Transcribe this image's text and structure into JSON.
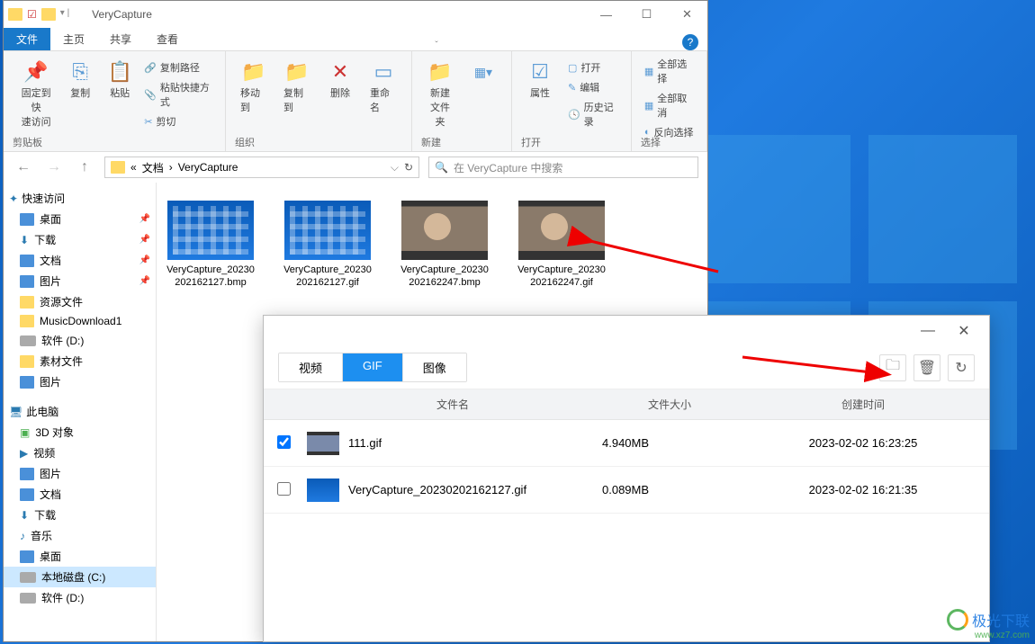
{
  "explorer": {
    "title": "VeryCapture",
    "tabs": {
      "file": "文件",
      "home": "主页",
      "share": "共享",
      "view": "查看"
    },
    "ribbon": {
      "pin": "固定到快\n速访问",
      "copy": "复制",
      "paste": "粘贴",
      "copyPath": "复制路径",
      "pasteShortcut": "粘贴快捷方式",
      "cut": "剪切",
      "clipboard": "剪贴板",
      "moveTo": "移动到",
      "copyTo": "复制到",
      "delete": "删除",
      "rename": "重命名",
      "organize": "组织",
      "newFolder": "新建\n文件夹",
      "new": "新建",
      "properties": "属性",
      "openLbl": "打开",
      "edit": "编辑",
      "history": "历史记录",
      "open": "打开",
      "selectAll": "全部选择",
      "selectNone": "全部取消",
      "selectInvert": "反向选择",
      "select": "选择"
    },
    "breadcrumb": {
      "seg1": "文档",
      "seg2": "VeryCapture",
      "sep": "›"
    },
    "searchPlaceholder": "在 VeryCapture 中搜索",
    "sidebar": {
      "quickAccess": "快速访问",
      "desktop": "桌面",
      "downloads": "下载",
      "documents": "文档",
      "pictures": "图片",
      "resources": "资源文件",
      "music": "MusicDownload1",
      "diskD": "软件 (D:)",
      "material": "素材文件",
      "pictures2": "图片",
      "thisPC": "此电脑",
      "obj3d": "3D 对象",
      "videos": "视频",
      "pictures3": "图片",
      "documents2": "文档",
      "downloads2": "下载",
      "musics": "音乐",
      "desktop2": "桌面",
      "diskC": "本地磁盘 (C:)",
      "diskD2": "软件 (D:)"
    },
    "files": [
      {
        "name": "VeryCapture_20230202162127.bmp",
        "type": "desktop"
      },
      {
        "name": "VeryCapture_20230202162127.gif",
        "type": "desktop"
      },
      {
        "name": "VeryCapture_20230202162247.bmp",
        "type": "video"
      },
      {
        "name": "VeryCapture_20230202162247.gif",
        "type": "video"
      }
    ]
  },
  "app2": {
    "tabs": {
      "video": "视频",
      "gif": "GIF",
      "image": "图像"
    },
    "headers": {
      "name": "文件名",
      "size": "文件大小",
      "time": "创建时间"
    },
    "rows": [
      {
        "checked": true,
        "name": "111.gif",
        "size": "4.940MB",
        "time": "2023-02-02 16:23:25",
        "thumb": "dark"
      },
      {
        "checked": false,
        "name": "VeryCapture_20230202162127.gif",
        "size": "0.089MB",
        "time": "2023-02-02 16:21:35",
        "thumb": "blue"
      }
    ]
  },
  "watermark": {
    "text": "极光下联",
    "sub": "www.xz7.com"
  }
}
